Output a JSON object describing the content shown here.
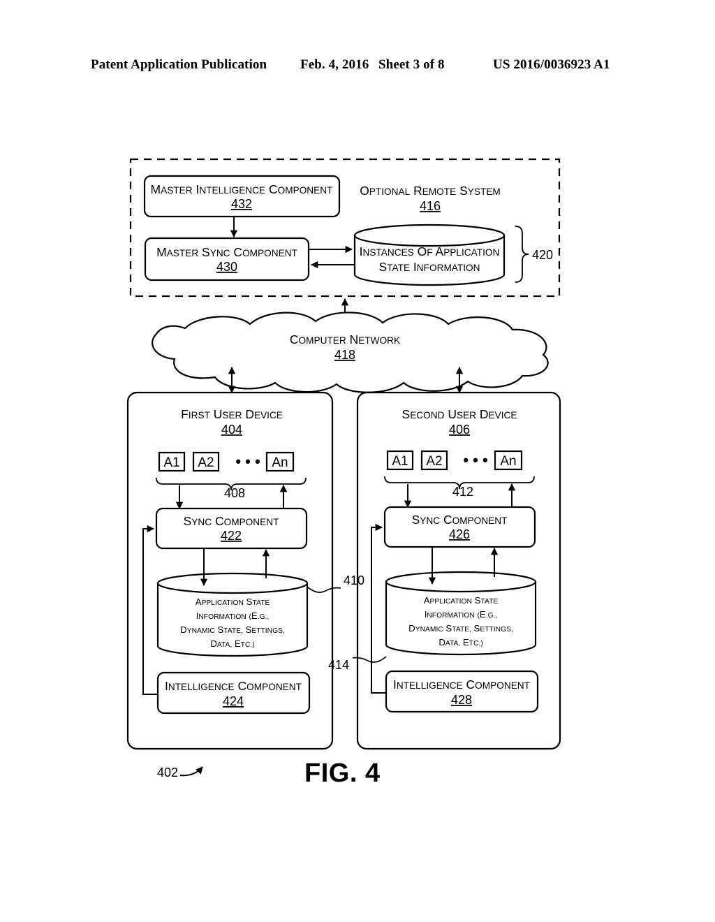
{
  "header": {
    "publication": "Patent Application Publication",
    "date": "Feb. 4, 2016",
    "sheet": "Sheet 3 of 8",
    "patent_number": "US 2016/0036923 A1"
  },
  "figure": {
    "caption": "FIG. 4",
    "system_ref": "402",
    "remote_system": {
      "title": "Optional Remote System",
      "ref": "416",
      "master_intelligence": {
        "label": "Master Intelligence Component",
        "ref": "432"
      },
      "master_sync": {
        "label": "Master Sync Component",
        "ref": "430"
      },
      "instances_db": {
        "line1": "Instances of Application",
        "line2": "State Information",
        "ref": "420"
      }
    },
    "network": {
      "label": "Computer Network",
      "ref": "418"
    },
    "first_device": {
      "title": "First User Device",
      "ref": "404",
      "apps": [
        "A1",
        "A2",
        "•  •  •",
        "An"
      ],
      "apps_ref": "408",
      "sync": {
        "label": "Sync Component",
        "ref": "422"
      },
      "state_db": {
        "line1": "Application State",
        "line2": "Information (e.g.,",
        "line3": "Dynamic State, Settings,",
        "line4": "Data, etc.)"
      },
      "intelligence": {
        "label": "Intelligence Component",
        "ref": "424"
      }
    },
    "second_device": {
      "title": "Second User Device",
      "ref": "406",
      "apps": [
        "A1",
        "A2",
        "•  •  •",
        "An"
      ],
      "apps_ref": "412",
      "sync": {
        "label": "Sync Component",
        "ref": "426"
      },
      "state_db": {
        "line1": "Application State",
        "line2": "Information (e.g.,",
        "line3": "Dynamic State, Settings,",
        "line4": "Data, etc.)"
      },
      "intelligence": {
        "label": "Intelligence Component",
        "ref": "428"
      }
    },
    "connector_refs": {
      "upper": "410",
      "lower": "414"
    }
  },
  "colors": {
    "ink": "#000000",
    "paper": "#ffffff"
  }
}
